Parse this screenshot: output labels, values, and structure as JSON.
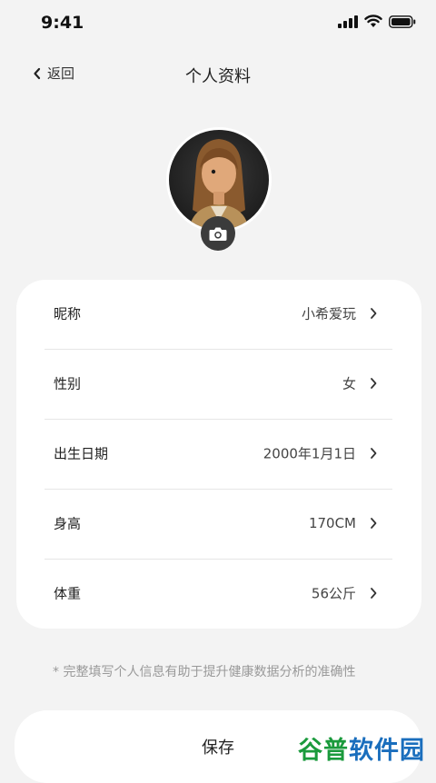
{
  "status_bar": {
    "time": "9:41"
  },
  "nav": {
    "back_label": "返回",
    "title": "个人资料"
  },
  "profile": {
    "rows": [
      {
        "label": "昵称",
        "value": "小希爱玩"
      },
      {
        "label": "性别",
        "value": "女"
      },
      {
        "label": "出生日期",
        "value": "2000年1月1日"
      },
      {
        "label": "身高",
        "value": "170CM"
      },
      {
        "label": "体重",
        "value": "56公斤"
      }
    ]
  },
  "hint": "* 完整填写个人信息有助于提升健康数据分析的准确性",
  "save_label": "保存",
  "watermark": {
    "part1": "谷普",
    "part2": "软件园"
  },
  "icons": [
    "signal-icon",
    "wifi-icon",
    "battery-icon",
    "back-chevron-icon",
    "camera-icon",
    "chevron-right-icon"
  ],
  "colors": {
    "background": "#f3f3f3",
    "card": "#ffffff",
    "camera_button": "#3b3b3b",
    "hint": "#999999"
  }
}
